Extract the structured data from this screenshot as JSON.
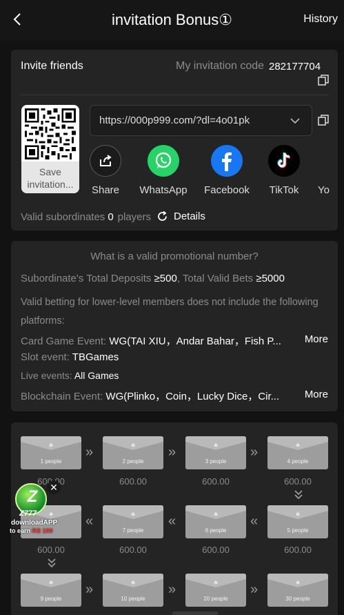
{
  "header": {
    "title": "invitation Bonus①",
    "history_label": "History"
  },
  "invite": {
    "title": "Invite friends",
    "code_label": "My invitation code",
    "code_value": "282177704",
    "qr_label": "Save invitation...",
    "link": "https://000p999.com/?dl=4o01pk"
  },
  "share": [
    {
      "label": "Share",
      "icon": "share-icon"
    },
    {
      "label": "WhatsApp",
      "icon": "whatsapp-icon"
    },
    {
      "label": "Facebook",
      "icon": "facebook-icon"
    },
    {
      "label": "TikTok",
      "icon": "tiktok-icon"
    },
    {
      "label": "Yo",
      "icon": "youtube-icon"
    }
  ],
  "subordinates": {
    "label": "Valid subordinates",
    "count": "0",
    "unit": "players",
    "details_label": "Details"
  },
  "rules": {
    "question": "What is a valid promotional number?",
    "deposits_label": "Subordinate's Total Deposits",
    "deposits_value": "≥500",
    "bets_label": "Total Valid Bets",
    "bets_value": "≥5000",
    "note_line1": "Valid betting for lower-level members does not include the following",
    "note_line2": "platforms:",
    "card_label": "Card Game Event:",
    "card_value": "WG(TAI XIU，Andar Bahar，Fish P...",
    "slot_label": "Slot event:",
    "slot_value": "TBGames",
    "live_label": "Live events:",
    "live_value": "All Games",
    "block_label": "Blockchain Event:",
    "block_value": "WG(Plinko，Coin，Lucky Dice，Cir...",
    "more_label": "More"
  },
  "rewards": [
    {
      "people": "1 people",
      "amount": "600.00"
    },
    {
      "people": "2 people",
      "amount": "600.00"
    },
    {
      "people": "3 people",
      "amount": "600.00"
    },
    {
      "people": "4 people",
      "amount": "600.00"
    },
    {
      "people": "5 people",
      "amount": "600.00"
    },
    {
      "people": "6 people",
      "amount": "600.00"
    },
    {
      "people": "7 people",
      "amount": "600.00"
    },
    {
      "people": "8 people",
      "amount": "600.00"
    },
    {
      "people": "9 people",
      "amount": ""
    },
    {
      "people": "10 people",
      "amount": ""
    },
    {
      "people": "20 people",
      "amount": ""
    },
    {
      "people": "30 people",
      "amount": ""
    }
  ],
  "promo": {
    "brand": "Z777",
    "line1": "downloadAPP",
    "line2_prefix": "to earn",
    "line2_amount": "RS 100"
  },
  "colors": {
    "background": "#121212",
    "card": "#242424",
    "muted_text": "#8b8b8b",
    "whatsapp": "#25d366",
    "facebook": "#1877f2",
    "tiktok": "#000000"
  }
}
